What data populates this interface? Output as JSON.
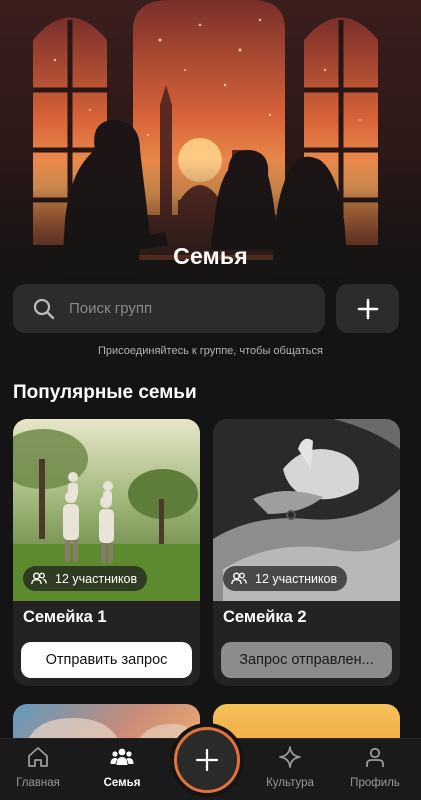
{
  "hero": {
    "title": "Семья"
  },
  "search": {
    "placeholder": "Поиск групп"
  },
  "hint": "Присоединяйтесь к группе, чтобы общаться",
  "section": {
    "title": "Популярные семьи"
  },
  "cards": [
    {
      "name": "Семейка 1",
      "members": "12 участников",
      "button": "Отправить запрос",
      "state": "default"
    },
    {
      "name": "Семейка 2",
      "members": "12 участников",
      "button": "Запрос отправлен...",
      "state": "sent"
    }
  ],
  "nav": {
    "items": [
      {
        "label": "Главная",
        "icon": "home-icon",
        "active": false
      },
      {
        "label": "Семья",
        "icon": "family-icon",
        "active": true
      },
      {
        "label": "Культура",
        "icon": "sparkle-icon",
        "active": false
      },
      {
        "label": "Профиль",
        "icon": "profile-icon",
        "active": false
      }
    ],
    "fab_icon": "plus-icon"
  },
  "colors": {
    "background": "#141414",
    "surface": "#232323",
    "accent": "#e0723a"
  }
}
